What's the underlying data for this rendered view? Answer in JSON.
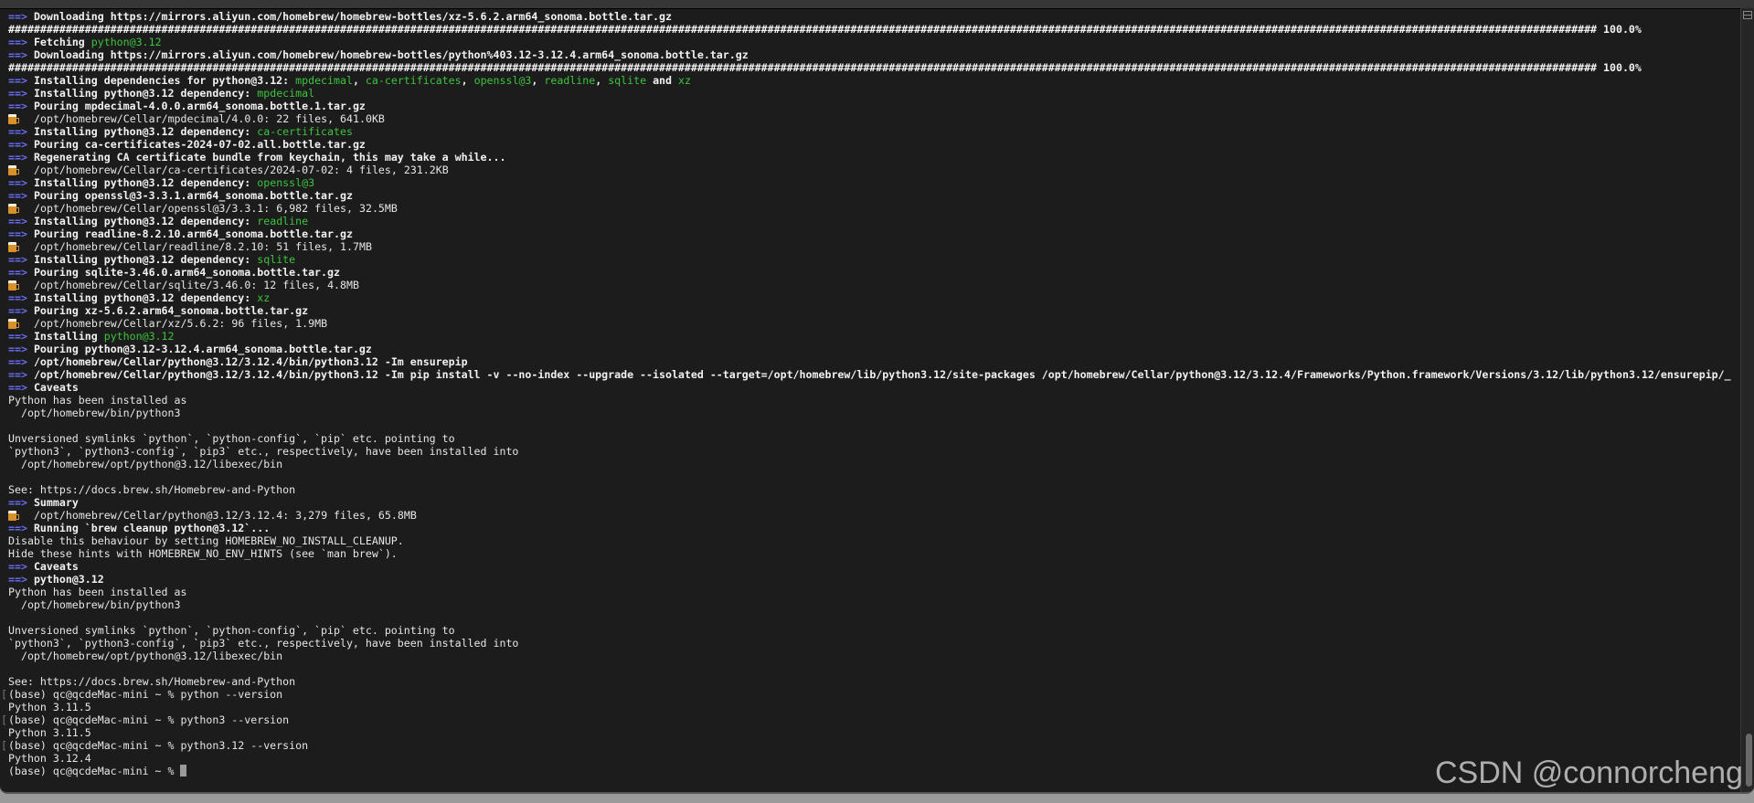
{
  "colors": {
    "arrow": "#6a6ff5",
    "green": "#3cc43c",
    "background": "#1c1c1c"
  },
  "watermark": "CSDN @connorcheng",
  "lines": [
    {
      "type": "arrow",
      "segs": [
        {
          "t": "Downloading https://mirrors.aliyun.com/homebrew/homebrew-bottles/xz-5.6.2.arm64_sonoma.bottle.tar.gz",
          "c": "b"
        }
      ]
    },
    {
      "type": "plain",
      "segs": [
        {
          "t": "######################################################################################################################################################################################################################################################### 100.0%",
          "c": "b"
        }
      ]
    },
    {
      "type": "arrow",
      "segs": [
        {
          "t": "Fetching ",
          "c": "b"
        },
        {
          "t": "python@3.12",
          "c": "g"
        }
      ]
    },
    {
      "type": "arrow",
      "segs": [
        {
          "t": "Downloading https://mirrors.aliyun.com/homebrew/homebrew-bottles/python%403.12-3.12.4.arm64_sonoma.bottle.tar.gz",
          "c": "b"
        }
      ]
    },
    {
      "type": "plain",
      "segs": [
        {
          "t": "######################################################################################################################################################################################################################################################### 100.0%",
          "c": "b"
        }
      ]
    },
    {
      "type": "arrow",
      "segs": [
        {
          "t": "Installing dependencies for python@3.12: ",
          "c": "b"
        },
        {
          "t": "mpdecimal",
          "c": "g"
        },
        {
          "t": ", ",
          "c": "b"
        },
        {
          "t": "ca-certificates",
          "c": "g"
        },
        {
          "t": ", ",
          "c": "b"
        },
        {
          "t": "openssl@3",
          "c": "g"
        },
        {
          "t": ", ",
          "c": "b"
        },
        {
          "t": "readline",
          "c": "g"
        },
        {
          "t": ", ",
          "c": "b"
        },
        {
          "t": "sqlite",
          "c": "g"
        },
        {
          "t": " and ",
          "c": "b"
        },
        {
          "t": "xz",
          "c": "g"
        }
      ]
    },
    {
      "type": "arrow",
      "segs": [
        {
          "t": "Installing python@3.12 dependency: ",
          "c": "b"
        },
        {
          "t": "mpdecimal",
          "c": "g"
        }
      ]
    },
    {
      "type": "arrow",
      "segs": [
        {
          "t": "Pouring mpdecimal-4.0.0.arm64_sonoma.bottle.1.tar.gz",
          "c": "b"
        }
      ]
    },
    {
      "type": "beer",
      "segs": [
        {
          "t": "/opt/homebrew/Cellar/mpdecimal/4.0.0: 22 files, 641.0KB",
          "c": ""
        }
      ]
    },
    {
      "type": "arrow",
      "segs": [
        {
          "t": "Installing python@3.12 dependency: ",
          "c": "b"
        },
        {
          "t": "ca-certificates",
          "c": "g"
        }
      ]
    },
    {
      "type": "arrow",
      "segs": [
        {
          "t": "Pouring ca-certificates-2024-07-02.all.bottle.tar.gz",
          "c": "b"
        }
      ]
    },
    {
      "type": "arrow",
      "segs": [
        {
          "t": "Regenerating CA certificate bundle from keychain, this may take a while...",
          "c": "b"
        }
      ]
    },
    {
      "type": "beer",
      "segs": [
        {
          "t": "/opt/homebrew/Cellar/ca-certificates/2024-07-02: 4 files, 231.2KB",
          "c": ""
        }
      ]
    },
    {
      "type": "arrow",
      "segs": [
        {
          "t": "Installing python@3.12 dependency: ",
          "c": "b"
        },
        {
          "t": "openssl@3",
          "c": "g"
        }
      ]
    },
    {
      "type": "arrow",
      "segs": [
        {
          "t": "Pouring openssl@3-3.3.1.arm64_sonoma.bottle.tar.gz",
          "c": "b"
        }
      ]
    },
    {
      "type": "beer",
      "segs": [
        {
          "t": "/opt/homebrew/Cellar/openssl@3/3.3.1: 6,982 files, 32.5MB",
          "c": ""
        }
      ]
    },
    {
      "type": "arrow",
      "segs": [
        {
          "t": "Installing python@3.12 dependency: ",
          "c": "b"
        },
        {
          "t": "readline",
          "c": "g"
        }
      ]
    },
    {
      "type": "arrow",
      "segs": [
        {
          "t": "Pouring readline-8.2.10.arm64_sonoma.bottle.tar.gz",
          "c": "b"
        }
      ]
    },
    {
      "type": "beer",
      "segs": [
        {
          "t": "/opt/homebrew/Cellar/readline/8.2.10: 51 files, 1.7MB",
          "c": ""
        }
      ]
    },
    {
      "type": "arrow",
      "segs": [
        {
          "t": "Installing python@3.12 dependency: ",
          "c": "b"
        },
        {
          "t": "sqlite",
          "c": "g"
        }
      ]
    },
    {
      "type": "arrow",
      "segs": [
        {
          "t": "Pouring sqlite-3.46.0.arm64_sonoma.bottle.tar.gz",
          "c": "b"
        }
      ]
    },
    {
      "type": "beer",
      "segs": [
        {
          "t": "/opt/homebrew/Cellar/sqlite/3.46.0: 12 files, 4.8MB",
          "c": ""
        }
      ]
    },
    {
      "type": "arrow",
      "segs": [
        {
          "t": "Installing python@3.12 dependency: ",
          "c": "b"
        },
        {
          "t": "xz",
          "c": "g"
        }
      ]
    },
    {
      "type": "arrow",
      "segs": [
        {
          "t": "Pouring xz-5.6.2.arm64_sonoma.bottle.tar.gz",
          "c": "b"
        }
      ]
    },
    {
      "type": "beer",
      "segs": [
        {
          "t": "/opt/homebrew/Cellar/xz/5.6.2: 96 files, 1.9MB",
          "c": ""
        }
      ]
    },
    {
      "type": "arrow",
      "segs": [
        {
          "t": "Installing ",
          "c": "b"
        },
        {
          "t": "python@3.12",
          "c": "g"
        }
      ]
    },
    {
      "type": "arrow",
      "segs": [
        {
          "t": "Pouring python@3.12-3.12.4.arm64_sonoma.bottle.tar.gz",
          "c": "b"
        }
      ]
    },
    {
      "type": "arrow",
      "segs": [
        {
          "t": "/opt/homebrew/Cellar/python@3.12/3.12.4/bin/python3.12 -Im ensurepip",
          "c": "b"
        }
      ]
    },
    {
      "type": "arrow",
      "segs": [
        {
          "t": "/opt/homebrew/Cellar/python@3.12/3.12.4/bin/python3.12 -Im pip install -v --no-index --upgrade --isolated --target=/opt/homebrew/lib/python3.12/site-packages /opt/homebrew/Cellar/python@3.12/3.12.4/Frameworks/Python.framework/Versions/3.12/lib/python3.12/ensurepip/_",
          "c": "b"
        }
      ]
    },
    {
      "type": "arrow",
      "segs": [
        {
          "t": "Caveats",
          "c": "b"
        }
      ]
    },
    {
      "type": "plain",
      "segs": [
        {
          "t": "Python has been installed as",
          "c": ""
        }
      ]
    },
    {
      "type": "plain",
      "segs": [
        {
          "t": "  /opt/homebrew/bin/python3",
          "c": ""
        }
      ]
    },
    {
      "type": "plain",
      "segs": []
    },
    {
      "type": "plain",
      "segs": [
        {
          "t": "Unversioned symlinks `python`, `python-config`, `pip` etc. pointing to",
          "c": ""
        }
      ]
    },
    {
      "type": "plain",
      "segs": [
        {
          "t": "`python3`, `python3-config`, `pip3` etc., respectively, have been installed into",
          "c": ""
        }
      ]
    },
    {
      "type": "plain",
      "segs": [
        {
          "t": "  /opt/homebrew/opt/python@3.12/libexec/bin",
          "c": ""
        }
      ]
    },
    {
      "type": "plain",
      "segs": []
    },
    {
      "type": "plain",
      "segs": [
        {
          "t": "See: https://docs.brew.sh/Homebrew-and-Python",
          "c": ""
        }
      ]
    },
    {
      "type": "arrow",
      "segs": [
        {
          "t": "Summary",
          "c": "b"
        }
      ]
    },
    {
      "type": "beer",
      "segs": [
        {
          "t": "/opt/homebrew/Cellar/python@3.12/3.12.4: 3,279 files, 65.8MB",
          "c": ""
        }
      ]
    },
    {
      "type": "arrow",
      "segs": [
        {
          "t": "Running `brew cleanup python@3.12`...",
          "c": "b"
        }
      ]
    },
    {
      "type": "plain",
      "segs": [
        {
          "t": "Disable this behaviour by setting HOMEBREW_NO_INSTALL_CLEANUP.",
          "c": ""
        }
      ]
    },
    {
      "type": "plain",
      "segs": [
        {
          "t": "Hide these hints with HOMEBREW_NO_ENV_HINTS (see `man brew`).",
          "c": ""
        }
      ]
    },
    {
      "type": "arrow",
      "segs": [
        {
          "t": "Caveats",
          "c": "b"
        }
      ]
    },
    {
      "type": "arrow",
      "segs": [
        {
          "t": "python@3.12",
          "c": "b"
        }
      ]
    },
    {
      "type": "plain",
      "segs": [
        {
          "t": "Python has been installed as",
          "c": ""
        }
      ]
    },
    {
      "type": "plain",
      "segs": [
        {
          "t": "  /opt/homebrew/bin/python3",
          "c": ""
        }
      ]
    },
    {
      "type": "plain",
      "segs": []
    },
    {
      "type": "plain",
      "segs": [
        {
          "t": "Unversioned symlinks `python`, `python-config`, `pip` etc. pointing to",
          "c": ""
        }
      ]
    },
    {
      "type": "plain",
      "segs": [
        {
          "t": "`python3`, `python3-config`, `pip3` etc., respectively, have been installed into",
          "c": ""
        }
      ]
    },
    {
      "type": "plain",
      "segs": [
        {
          "t": "  /opt/homebrew/opt/python@3.12/libexec/bin",
          "c": ""
        }
      ]
    },
    {
      "type": "plain",
      "segs": []
    },
    {
      "type": "plain",
      "segs": [
        {
          "t": "See: https://docs.brew.sh/Homebrew-and-Python",
          "c": ""
        }
      ]
    },
    {
      "type": "prompt",
      "segs": [
        {
          "t": "(base) qc@qcdeMac-mini ~ % python --version",
          "c": ""
        }
      ]
    },
    {
      "type": "plain",
      "segs": [
        {
          "t": "Python 3.11.5",
          "c": ""
        }
      ]
    },
    {
      "type": "prompt",
      "segs": [
        {
          "t": "(base) qc@qcdeMac-mini ~ % python3 --version",
          "c": ""
        }
      ]
    },
    {
      "type": "plain",
      "segs": [
        {
          "t": "Python 3.11.5",
          "c": ""
        }
      ]
    },
    {
      "type": "prompt",
      "segs": [
        {
          "t": "(base) qc@qcdeMac-mini ~ % python3.12 --version",
          "c": ""
        }
      ]
    },
    {
      "type": "plain",
      "segs": [
        {
          "t": "Python 3.12.4",
          "c": ""
        }
      ]
    },
    {
      "type": "current",
      "segs": [
        {
          "t": "(base) qc@qcdeMac-mini ~ % ",
          "c": ""
        }
      ]
    }
  ],
  "arrow_glyph": "==>"
}
